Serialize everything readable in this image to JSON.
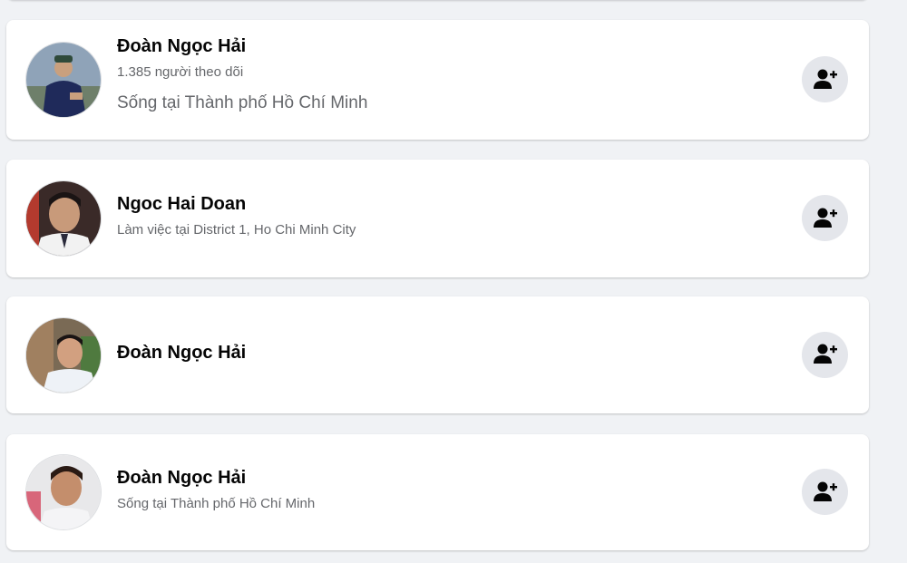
{
  "results": [
    {
      "name": "Đoàn Ngọc Hải",
      "detail": "1.385 người theo dõi",
      "location": "Sống tại Thành phố Hồ Chí Minh"
    },
    {
      "name": "Ngoc Hai Doan",
      "detail": "Làm việc tại District 1, Ho Chi Minh City"
    },
    {
      "name": "Đoàn Ngọc Hải"
    },
    {
      "name": "Đoàn Ngọc Hải",
      "detail": "Sống tại Thành phố Hồ Chí Minh"
    }
  ],
  "icons": {
    "add_friend": "add-friend-icon"
  },
  "colors": {
    "page_background": "#f0f2f5",
    "card_background": "#ffffff",
    "name_text": "#050505",
    "secondary_text": "#65676b",
    "button_background": "#e4e6eb"
  }
}
